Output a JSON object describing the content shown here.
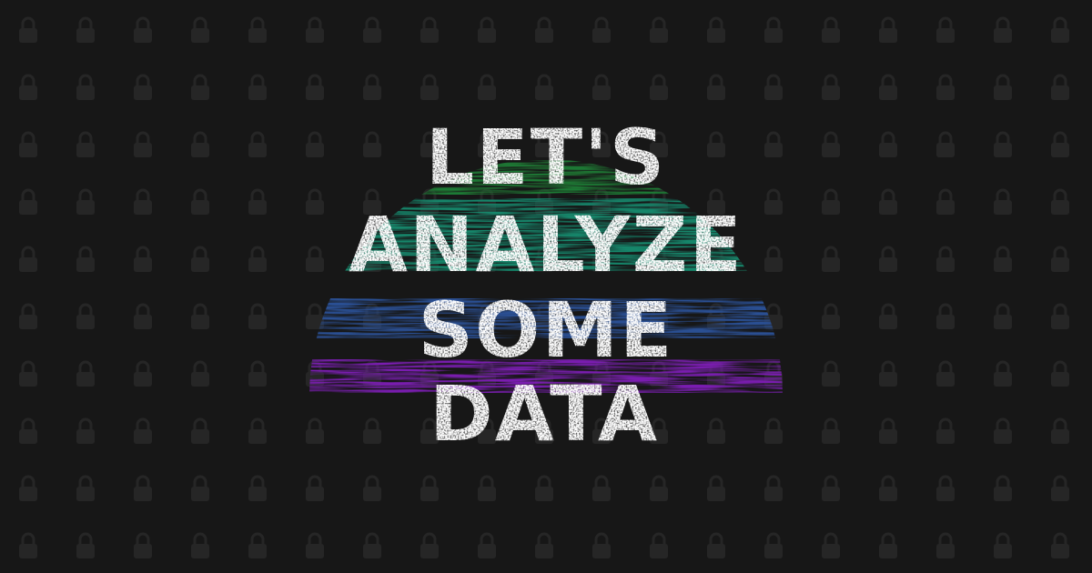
{
  "design": {
    "lines": [
      "LET'S",
      "ANALYZE",
      "SOME",
      "DATA"
    ]
  },
  "colors": {
    "background": "#171717",
    "watermark": "#262626",
    "text": "#ffffff",
    "stripes": [
      "#1f7a34",
      "#16866b",
      "#2a4f93",
      "#7a1fb0"
    ]
  },
  "icons": {
    "watermark": "padlock-icon"
  }
}
